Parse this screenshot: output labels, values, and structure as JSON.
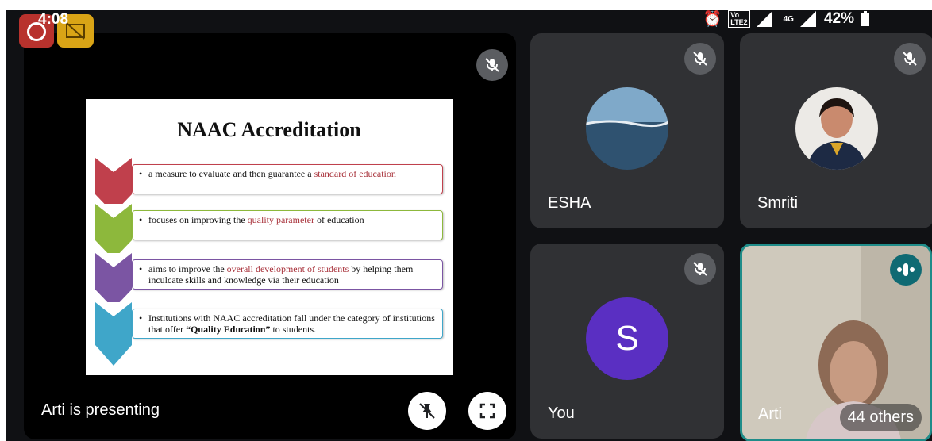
{
  "status_bar": {
    "time": "4:08",
    "network_tag_top": "Vo",
    "network_tag_bottom": "LTE2",
    "signal_label": "4G",
    "battery": "42%"
  },
  "presentation": {
    "slide": {
      "title": "NAAC Accreditation",
      "bullets": [
        {
          "pre": "a measure to evaluate and then guarantee a ",
          "hl": "standard of education",
          "post": "",
          "color": "#c0404c"
        },
        {
          "pre": "focuses on improving the ",
          "hl": "quality parameter",
          "post": " of education",
          "color": "#8db83c"
        },
        {
          "pre": "aims to improve the ",
          "hl": "overall development of students",
          "post": " by helping them inculcate skills and knowledge via their education",
          "color": "#7b55a3"
        },
        {
          "pre": "Institutions with NAAC accreditation fall under the category of institutions that offer ",
          "hl": "“Quality Education”",
          "post": " to students.",
          "color": "#3fa6c9"
        }
      ]
    },
    "presenting_label": "Arti is presenting"
  },
  "participants": [
    {
      "name": "ESHA",
      "avatar": "sea-photo",
      "muted": true
    },
    {
      "name": "Smriti",
      "avatar": "portrait-photo",
      "muted": true
    },
    {
      "name": "You",
      "avatar_letter": "S",
      "avatar_color": "#5a2fc2",
      "muted": true
    },
    {
      "name": "Arti",
      "video": true,
      "speaking": true
    }
  ],
  "others_label": "44 others",
  "colors": {
    "tile_bg": "#303134",
    "active_border": "#1f8c89"
  }
}
